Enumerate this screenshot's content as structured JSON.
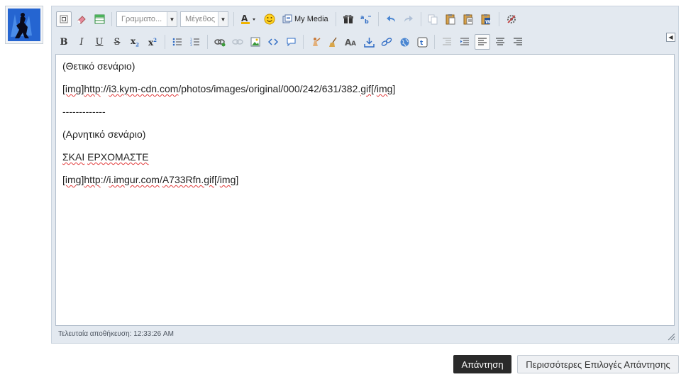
{
  "toolbar": {
    "font_placeholder": "Γραμματο...",
    "size_placeholder": "Μέγεθος",
    "my_media_label": "My Media",
    "icons_row1": [
      "bbcode-toggle-icon",
      "eraser-icon",
      "table-icon",
      "text-color-icon",
      "smiley-icon",
      "my-media-icon",
      "gift-icon",
      "spellcheck-icon",
      "undo-icon",
      "redo-icon",
      "copy-icon",
      "paste-icon",
      "paste-text-icon",
      "paste-word-icon",
      "settings-icon"
    ],
    "icons_row2": [
      "bold-icon",
      "italic-icon",
      "underline-icon",
      "strikethrough-icon",
      "subscript-icon",
      "superscript-icon",
      "bulleted-list-icon",
      "numbered-list-icon",
      "link-icon",
      "unlink-icon",
      "image-icon",
      "code-icon",
      "quote-icon",
      "spoiler-icon",
      "broom-icon",
      "font-size-icon",
      "download-icon",
      "chain-icon",
      "globe-icon",
      "twitter-icon",
      "outdent-icon",
      "indent-icon",
      "align-left-icon",
      "align-center-icon",
      "align-right-icon"
    ]
  },
  "content": {
    "line1": "(Θετικό σενάριο)",
    "line2_a": "[img]",
    "line2_b": "http",
    "line2_c": "://",
    "line2_d": "i3.kym-cdn.com",
    "line2_e": "/photos/images/original/000/242/631/382.",
    "line2_f": "gif",
    "line2_g": "[/",
    "line2_h": "img",
    "line2_i": "]",
    "line3": "-------------",
    "line4": "(Αρνητικό σενάριο)",
    "line5_a": "ΣΚΑΙ",
    "line5_b": " ",
    "line5_c": "ΕΡΧΟΜΑΣΤΕ",
    "line6_a": "[img]",
    "line6_b": "http",
    "line6_c": "://",
    "line6_d": "i.imgur.com",
    "line6_e": "/",
    "line6_f": "A733Rfn.gif",
    "line6_g": "[/",
    "line6_h": "img",
    "line6_i": "]"
  },
  "status": {
    "last_saved": "Τελευταία αποθήκευση: 12:33:26 AM"
  },
  "actions": {
    "reply_label": "Απάντηση",
    "more_options_label": "Περισσότερες Επιλογές Απάντησης"
  },
  "colors": {
    "frame_bg": "#e3e9f0",
    "reply_bg": "#2a2a2a",
    "spell_underline": "#e23b3b"
  }
}
